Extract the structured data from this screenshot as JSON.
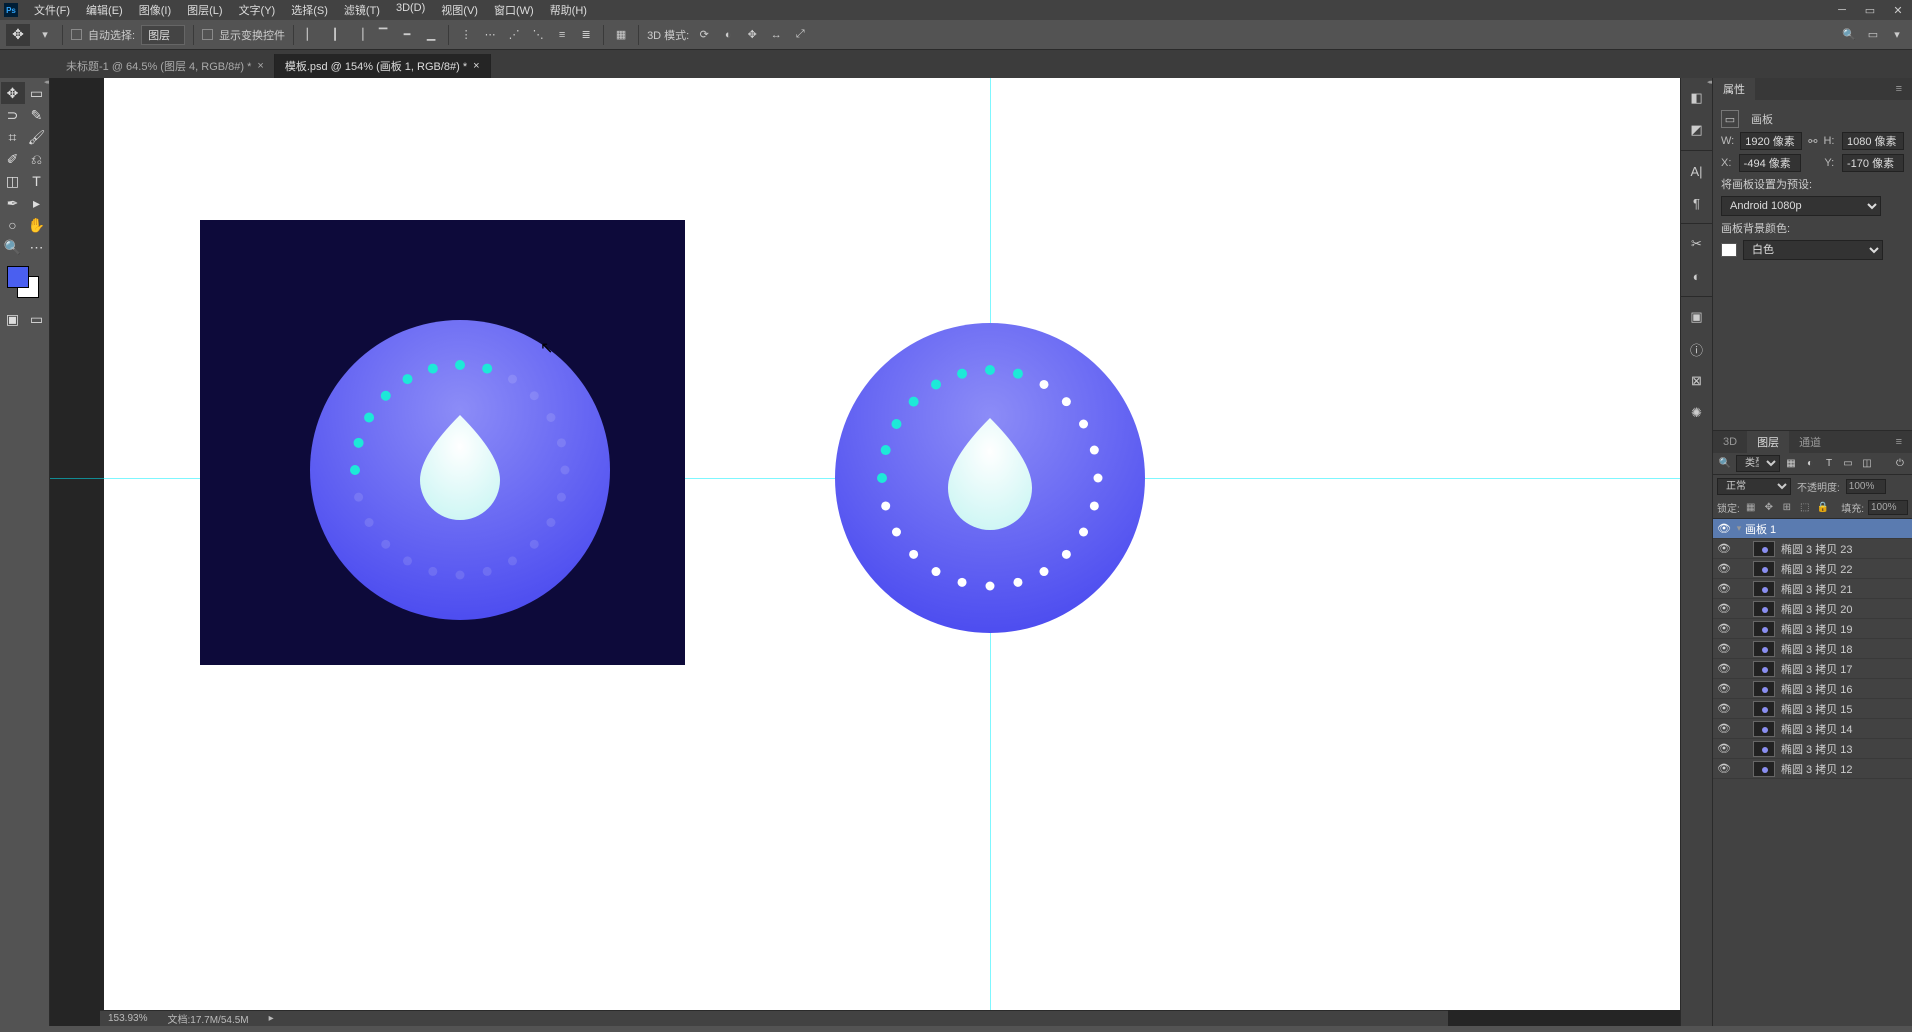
{
  "menu": [
    "文件(F)",
    "编辑(E)",
    "图像(I)",
    "图层(L)",
    "文字(Y)",
    "选择(S)",
    "滤镜(T)",
    "3D(D)",
    "视图(V)",
    "窗口(W)",
    "帮助(H)"
  ],
  "optionbar": {
    "auto_select_label": "自动选择:",
    "layer_dropdown": "图层",
    "show_transform_label": "显示变换控件",
    "mode3d_label": "3D 模式:"
  },
  "tabs": [
    {
      "title": "未标题-1 @ 64.5% (图层 4, RGB/8#) *",
      "active": false
    },
    {
      "title": "模板.psd @ 154% (画板 1, RGB/8#) *",
      "active": true
    }
  ],
  "properties": {
    "panel_title": "属性",
    "type_label": "画板",
    "w_label": "W:",
    "w_value": "1920 像素",
    "h_label": "H:",
    "h_value": "1080 像素",
    "x_label": "X:",
    "x_value": "-494 像素",
    "y_label": "Y:",
    "y_value": "-170 像素",
    "preset_label": "将画板设置为预设:",
    "preset_value": "Android 1080p",
    "bgcolor_label": "画板背景颜色:",
    "bgcolor_value": "白色"
  },
  "layers_panel": {
    "tabs": [
      "3D",
      "图层",
      "通道"
    ],
    "type_filter": "类型",
    "blend_mode": "正常",
    "opacity_label": "不透明度:",
    "opacity_value": "100%",
    "lock_label": "锁定:",
    "fill_label": "填充:",
    "fill_value": "100%",
    "artboard_name": "画板 1",
    "layers": [
      "椭圆 3 拷贝 23",
      "椭圆 3 拷贝 22",
      "椭圆 3 拷贝 21",
      "椭圆 3 拷贝 20",
      "椭圆 3 拷贝 19",
      "椭圆 3 拷贝 18",
      "椭圆 3 拷贝 17",
      "椭圆 3 拷贝 16",
      "椭圆 3 拷贝 15",
      "椭圆 3 拷贝 14",
      "椭圆 3 拷贝 13",
      "椭圆 3 拷贝 12"
    ]
  },
  "statusbar": {
    "zoom": "153.93%",
    "doc": "文档:17.7M/54.5M"
  },
  "colors": {
    "dark_navy": "#0d0a3a",
    "circle_grad_top": "#7a7ff5",
    "circle_grad_bottom": "#4d4df0",
    "drop": "#d8fcfb",
    "dot_cyan": "#1de9d8",
    "dot_white": "#ffffff",
    "fg_swatch": "#4a5ff0"
  }
}
